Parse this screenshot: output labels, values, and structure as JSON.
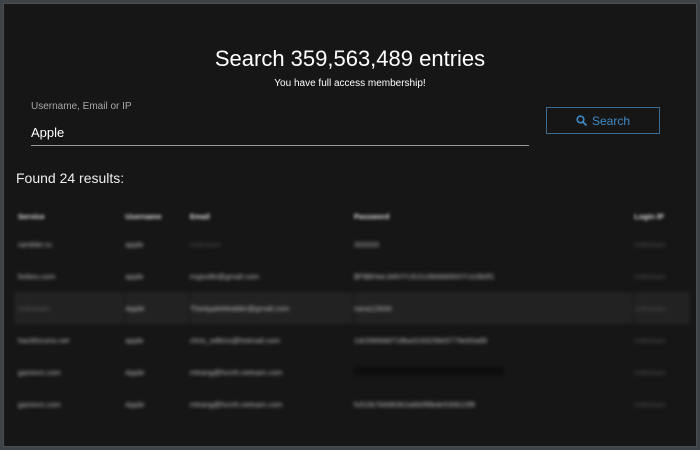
{
  "header": {
    "title": "Search 359,563,489 entries",
    "subtitle": "You have full access membership!"
  },
  "search": {
    "label": "Username, Email or IP",
    "value": "Apple",
    "button_label": "Search",
    "button_icon": "search-icon"
  },
  "results": {
    "summary": "Found 24 results:",
    "columns": [
      "Service",
      "Username",
      "Email",
      "Password",
      "Login IP"
    ],
    "rows": [
      {
        "service": "rambler.ru",
        "username": "apple",
        "email": "Unknown",
        "password": "333333",
        "login_ip": "Unknown"
      },
      {
        "service": "forbes.com",
        "username": "apple",
        "email": "myjoolle@gmail.com",
        "password": "$P$BHwL84h/YU5J1c6bMdrkh0YUc0b0f1",
        "login_ip": "Unknown"
      },
      {
        "service": "Unknown",
        "username": "Apple",
        "email": "TheAppleModder@gmail.com",
        "password": "nana12644",
        "login_ip": "Unknown"
      },
      {
        "service": "hackforums.net",
        "username": "apple",
        "email": "chris_wilkins@hotmail.com",
        "password": "1dc5969dd718ba3193258e5779e60a89",
        "login_ip": "Unknown"
      },
      {
        "service": "gamevn.com",
        "username": "Apple",
        "email": "mtrang@hcmh.netnam.com",
        "password": "",
        "login_ip": "Unknown"
      },
      {
        "service": "gamevn.com",
        "username": "Apple",
        "email": "mtrang@hcmh.netnam.com",
        "password": "fuf10b7b698362a6b0f8bde530b10f8",
        "login_ip": "Unknown"
      }
    ]
  },
  "colors": {
    "background": "#161616",
    "accent": "#3f8ac6",
    "text": "#ffffff"
  }
}
